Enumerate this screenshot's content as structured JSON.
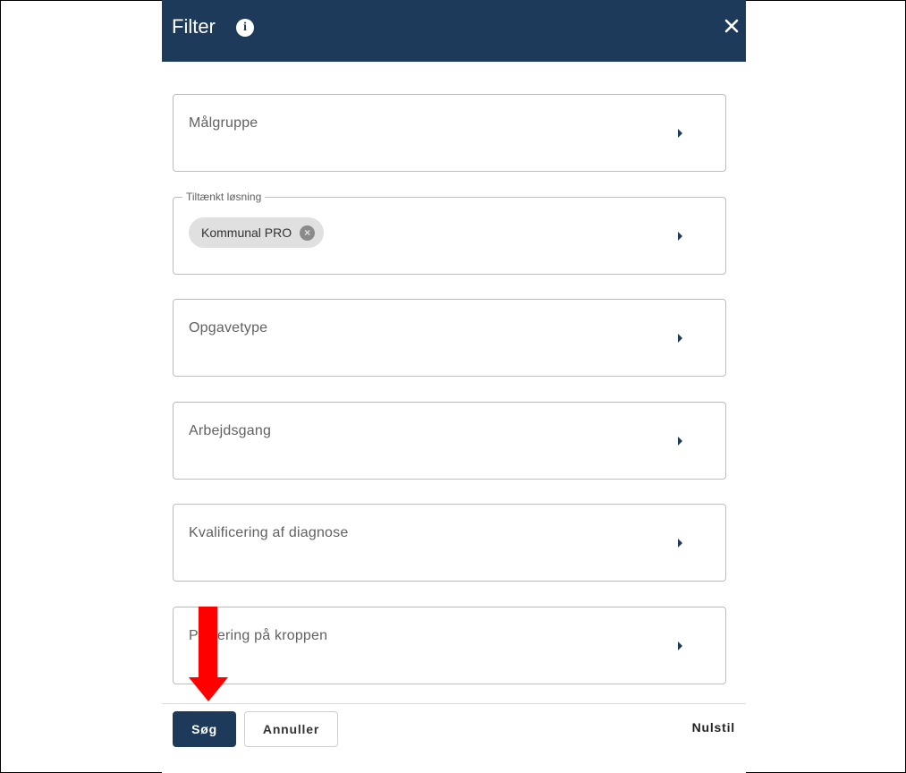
{
  "dialog": {
    "title": "Filter",
    "info_icon": "info-icon",
    "close_icon": "close-icon",
    "header_color": "#1e3a5a"
  },
  "fields": [
    {
      "label": "Målgruppe"
    },
    {
      "legend": "Tiltænkt løsning",
      "chip": "Kommunal PRO"
    },
    {
      "label": "Opgavetype"
    },
    {
      "label": "Arbejdsgang"
    },
    {
      "label": "Kvalificering af diagnose"
    },
    {
      "label": "Placering på kroppen"
    }
  ],
  "footer": {
    "search_label": "Søg",
    "cancel_label": "Annuller",
    "reset_label": "Nulstil"
  },
  "annotation": {
    "arrow_color": "#ff0000"
  }
}
